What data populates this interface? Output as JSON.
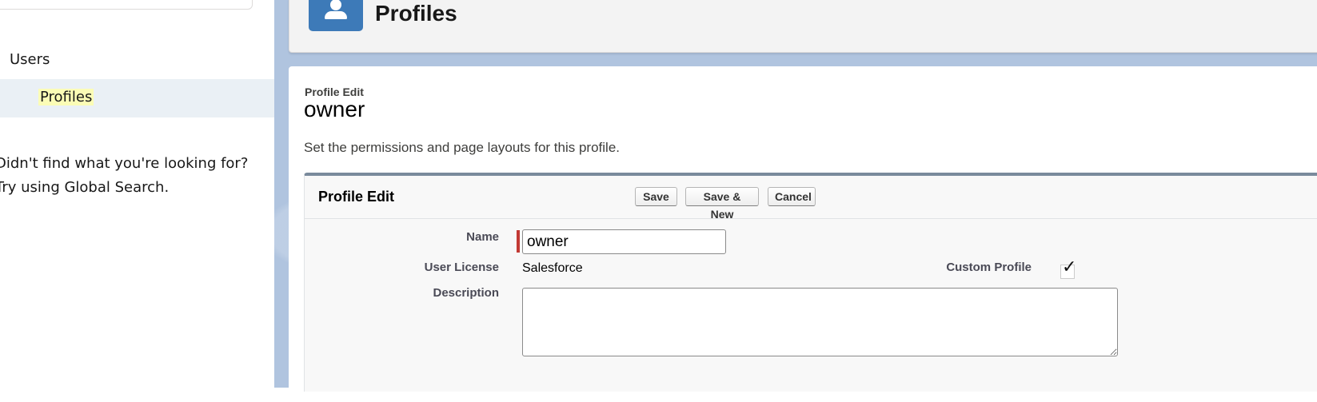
{
  "sidebar": {
    "parent_item": "Users",
    "active_child": "Profiles",
    "help_line1": "Didn't find what you're looking for?",
    "help_line2": "Try using Global Search."
  },
  "header": {
    "icon": "user-icon",
    "title": "Profiles",
    "icon_color": "#3d7ab8"
  },
  "page": {
    "crumb": "Profile Edit",
    "record_name": "owner",
    "description": "Set the permissions and page layouts for this profile."
  },
  "edit_block": {
    "title": "Profile Edit",
    "buttons": {
      "save": "Save",
      "save_new": "Save & New",
      "cancel": "Cancel"
    },
    "fields": {
      "name_label": "Name",
      "name_value": "owner",
      "license_label": "User License",
      "license_value": "Salesforce",
      "custom_profile_label": "Custom Profile",
      "custom_profile_checked": true,
      "description_label": "Description",
      "description_value": ""
    }
  }
}
